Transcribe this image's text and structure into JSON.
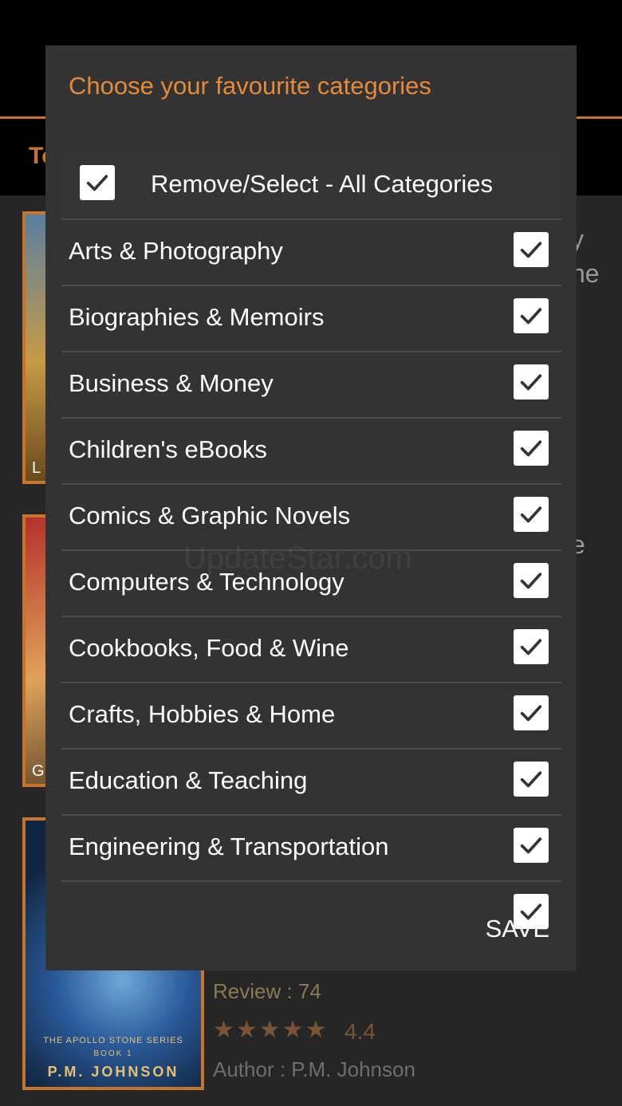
{
  "background": {
    "tab_fragment": "To",
    "side_fragments": [
      "y",
      "ne",
      "e"
    ],
    "covers": [
      {
        "letter": "L"
      },
      {
        "letter": "G"
      },
      {
        "series": "THE APOLLO STONE SERIES",
        "book": "BOOK 1",
        "author": "P.M. JOHNSON"
      }
    ],
    "review_label": "Review :",
    "review_count": "74",
    "stars": "★★★★★",
    "rating": "4.4",
    "author_label": "Author :",
    "author_name": "P.M. Johnson"
  },
  "dialog": {
    "title": "Choose your favourite categories",
    "select_all": {
      "label": "Remove/Select - All Categories",
      "checked": true,
      "icon": "checkmark-icon"
    },
    "categories": [
      {
        "label": "Arts & Photography",
        "checked": true
      },
      {
        "label": "Biographies & Memoirs",
        "checked": true
      },
      {
        "label": "Business & Money",
        "checked": true
      },
      {
        "label": "Children's eBooks",
        "checked": true
      },
      {
        "label": "Comics & Graphic Novels",
        "checked": true
      },
      {
        "label": "Computers & Technology",
        "checked": true
      },
      {
        "label": "Cookbooks, Food & Wine",
        "checked": true
      },
      {
        "label": "Crafts, Hobbies & Home",
        "checked": true
      },
      {
        "label": "Education & Teaching",
        "checked": true
      },
      {
        "label": "Engineering & Transportation",
        "checked": true
      },
      {
        "label": "",
        "checked": true
      }
    ],
    "save_label": "SAVE"
  },
  "watermark": "UpdateStar.com",
  "colors": {
    "accent": "#e58a3c",
    "dialog_bg": "#333333",
    "checkbox_bg": "#ffffff",
    "checkmark": "#333333"
  }
}
